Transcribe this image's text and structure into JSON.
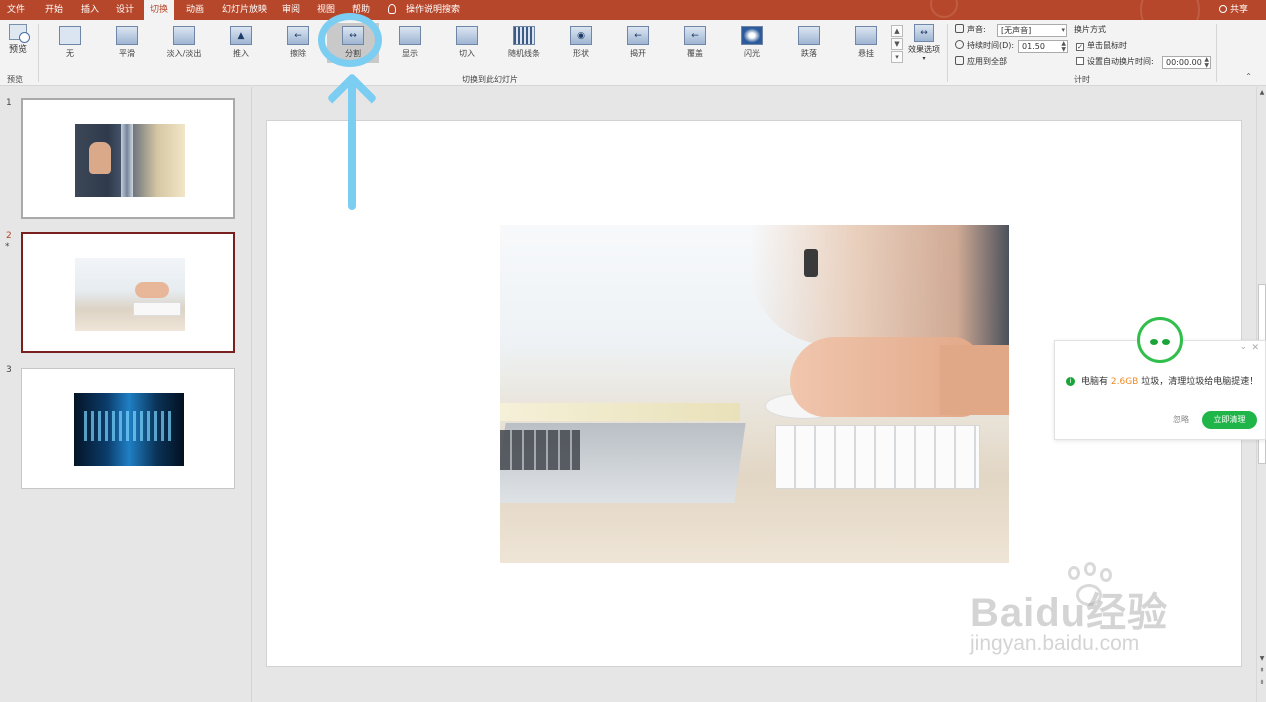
{
  "menu": {
    "items": [
      "文件",
      "开始",
      "插入",
      "设计",
      "切换",
      "动画",
      "幻灯片放映",
      "审阅",
      "视图",
      "帮助"
    ],
    "active_index": 4,
    "search": "操作说明搜索",
    "share": "共享"
  },
  "ribbon": {
    "preview": {
      "label": "预览",
      "group": "预览"
    },
    "transitions": [
      {
        "label": "无",
        "icon": "none-transition-icon"
      },
      {
        "label": "平滑",
        "icon": "morph-transition-icon"
      },
      {
        "label": "淡入/淡出",
        "icon": "fade-transition-icon"
      },
      {
        "label": "推入",
        "icon": "push-transition-icon"
      },
      {
        "label": "擦除",
        "icon": "wipe-transition-icon"
      },
      {
        "label": "分割",
        "icon": "split-transition-icon"
      },
      {
        "label": "显示",
        "icon": "reveal-transition-icon"
      },
      {
        "label": "切入",
        "icon": "cut-transition-icon"
      },
      {
        "label": "随机线条",
        "icon": "random-bars-transition-icon"
      },
      {
        "label": "形状",
        "icon": "shape-transition-icon"
      },
      {
        "label": "揭开",
        "icon": "uncover-transition-icon"
      },
      {
        "label": "覆盖",
        "icon": "cover-transition-icon"
      },
      {
        "label": "闪光",
        "icon": "flash-transition-icon"
      },
      {
        "label": "跌落",
        "icon": "fall-over-transition-icon"
      },
      {
        "label": "悬挂",
        "icon": "drape-transition-icon"
      }
    ],
    "selected_index": 5,
    "transition_group": "切换到此幻灯片",
    "effect_options": "效果选项",
    "timing": {
      "sound_label": "声音:",
      "sound_value": "[无声音]",
      "duration_label": "持续时间(D):",
      "duration_value": "01.50",
      "apply_all": "应用到全部",
      "advance_title": "换片方式",
      "on_click_label": "单击鼠标时",
      "on_click_checked": true,
      "after_label": "设置自动换片时间:",
      "after_checked": false,
      "after_value": "00:00.00",
      "group": "计时"
    }
  },
  "slides": [
    {
      "number": "1",
      "image": "business-thumbs-up"
    },
    {
      "number": "2",
      "image": "desk-keyboard",
      "current": true,
      "marker": "*"
    },
    {
      "number": "3",
      "image": "server-lights"
    }
  ],
  "notification": {
    "msg_before": "电脑有",
    "msg_highlight": "2.6GB",
    "msg_after": "垃圾，清理垃圾给电脑提速！",
    "ignore": "忽略",
    "action": "立即清理",
    "accent": "#20b548",
    "highlight_color": "#f08a24"
  },
  "watermark": {
    "brand": "Baidu经验",
    "url": "jingyan.baidu.com"
  },
  "colors": {
    "accent": "#b7472a",
    "annotation": "#7ccdf2"
  }
}
